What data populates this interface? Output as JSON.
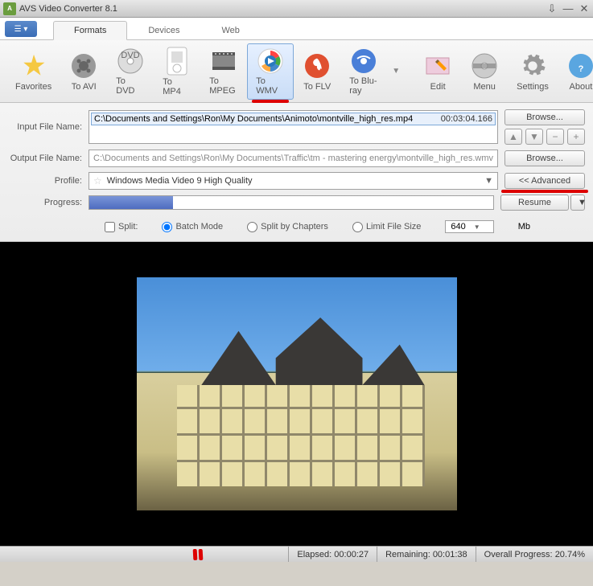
{
  "titlebar": {
    "title": "AVS Video Converter 8.1"
  },
  "tabs": {
    "formats": "Formats",
    "devices": "Devices",
    "web": "Web"
  },
  "toolbar": {
    "favorites": "Favorites",
    "toavi": "To AVI",
    "todvd": "To DVD",
    "tomp4": "To MP4",
    "tompeg": "To MPEG",
    "towmv": "To WMV",
    "toflv": "To FLV",
    "tobluray": "To Blu-ray",
    "edit": "Edit",
    "menu": "Menu",
    "settings": "Settings",
    "about": "About"
  },
  "form": {
    "input_label": "Input File Name:",
    "input_path": "C:\\Documents and Settings\\Ron\\My Documents\\Animoto\\montville_high_res.mp4",
    "input_duration": "00:03:04.166",
    "output_label": "Output File Name:",
    "output_path": "C:\\Documents and Settings\\Ron\\My Documents\\Traffic\\tm - mastering energy\\montville_high_res.wmv",
    "profile_label": "Profile:",
    "profile_value": "Windows Media Video 9 High Quality",
    "progress_label": "Progress:",
    "browse": "Browse...",
    "advanced": "<< Advanced",
    "resume": "Resume"
  },
  "options": {
    "split": "Split:",
    "batch": "Batch Mode",
    "chapters": "Split by Chapters",
    "limit": "Limit File Size",
    "size": "640",
    "mb": "Mb"
  },
  "status": {
    "elapsed_label": "Elapsed:",
    "elapsed": "00:00:27",
    "remaining_label": "Remaining:",
    "remaining": "00:01:38",
    "overall_label": "Overall Progress:",
    "overall": "20.74%"
  }
}
